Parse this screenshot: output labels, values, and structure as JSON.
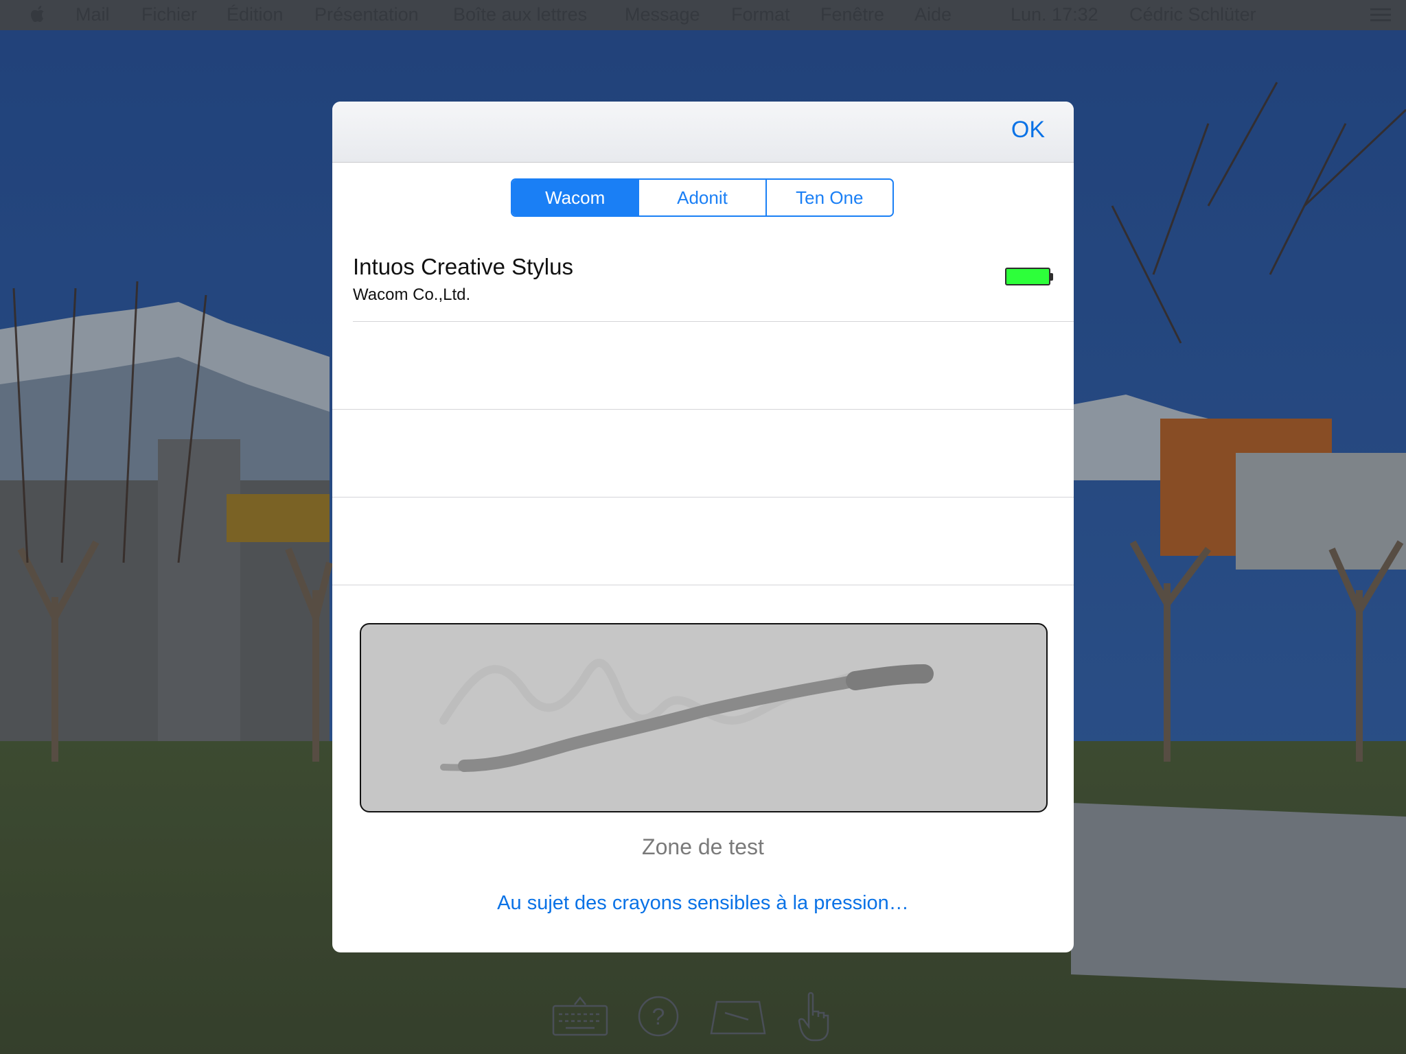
{
  "menubar": {
    "items": [
      "Mail",
      "Fichier",
      "Édition",
      "Présentation",
      "Boîte aux lettres",
      "Message",
      "Format",
      "Fenêtre",
      "Aide"
    ],
    "clock": "Lun. 17:32",
    "user": "Cédric Schlüter"
  },
  "dialog": {
    "ok_label": "OK",
    "tabs": [
      {
        "label": "Wacom",
        "active": true
      },
      {
        "label": "Adonit",
        "active": false
      },
      {
        "label": "Ten One",
        "active": false
      }
    ],
    "device": {
      "name": "Intuos Creative Stylus",
      "maker": "Wacom Co.,Ltd.",
      "battery_level": 1.0
    },
    "test_zone_label": "Zone de test",
    "about_link": "Au sujet des crayons sensibles à la pression…"
  },
  "toolbar": {
    "icons": [
      "keyboard-icon",
      "help-icon",
      "trackpad-icon",
      "hand-pointer-icon"
    ]
  },
  "colors": {
    "accent": "#1a7ff5",
    "battery": "#2dff3a",
    "test_zone": "#c6c6c6"
  }
}
